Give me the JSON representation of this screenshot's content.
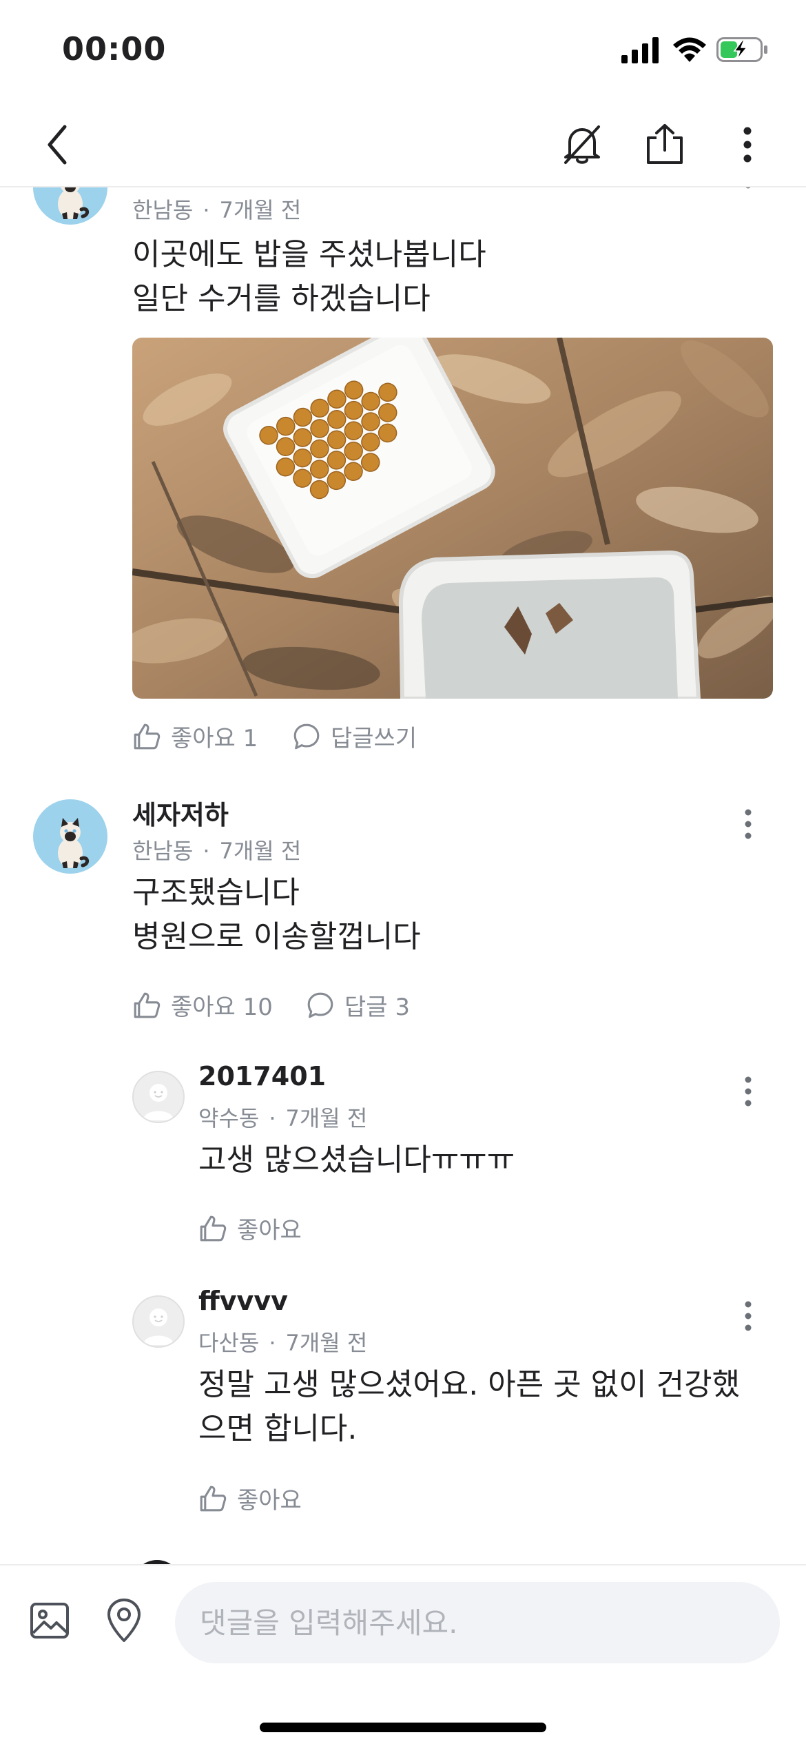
{
  "status": {
    "time": "00:00"
  },
  "comments": [
    {
      "region": "한남동",
      "time": "7개월 전",
      "lines": [
        "이곳에도 밥을 주셨나봅니다",
        "일단 수거를 하겠습니다"
      ],
      "like": "좋아요 1",
      "reply": "답글쓰기"
    },
    {
      "author": "세자저하",
      "region": "한남동",
      "time": "7개월 전",
      "lines": [
        "구조됐습니다",
        "병원으로 이송할껍니다"
      ],
      "like": "좋아요 10",
      "reply": "답글 3"
    }
  ],
  "replies": [
    {
      "author": "2017401",
      "region": "약수동",
      "time": "7개월 전",
      "lines": [
        "고생 많으셨습니다ㅠㅠㅠ"
      ],
      "like": "좋아요"
    },
    {
      "author": "ffvvvv",
      "region": "다산동",
      "time": "7개월 전",
      "lines": [
        "정말 고생 많으셨어요. 아픈 곳 없이 건강했",
        "으면 합니다."
      ],
      "like": "좋아요"
    }
  ],
  "input": {
    "placeholder": "댓글을 입력해주세요."
  },
  "icons": {
    "back": "chevron-left-icon",
    "mute": "bell-off-icon",
    "share": "share-icon",
    "more": "more-vertical-icon",
    "like": "thumbs-up-icon",
    "reply": "speech-bubble-icon",
    "image": "image-icon",
    "location": "location-pin-icon"
  },
  "colors": {
    "text": "#212124",
    "meta": "#868b94",
    "divider": "#ececec",
    "input_bg": "#f2f3f6",
    "avatar_bg": "#9cd2ec"
  }
}
